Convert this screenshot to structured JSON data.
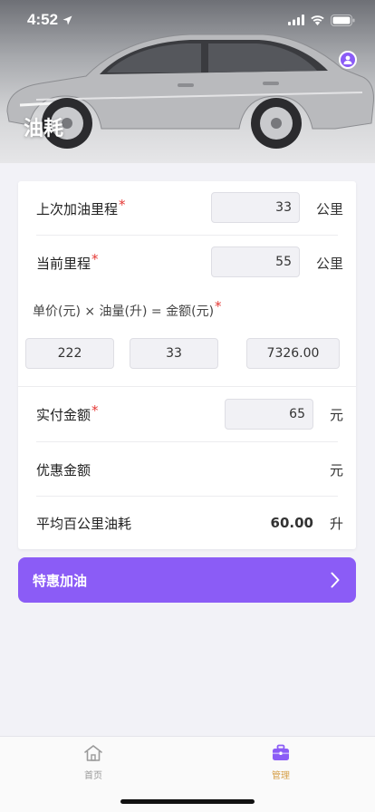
{
  "status": {
    "time": "4:52"
  },
  "header": {
    "title": "油耗"
  },
  "form": {
    "last_mileage": {
      "label": "上次加油里程",
      "value": "33",
      "unit": "公里",
      "required": "*"
    },
    "current_mileage": {
      "label": "当前里程",
      "value": "55",
      "unit": "公里",
      "required": "*"
    },
    "price_formula": {
      "label": "单价(元) × 油量(升) = 金额(元)",
      "required": "*",
      "unit_price": "222",
      "volume": "33",
      "amount": "7326.00"
    },
    "paid_amount": {
      "label": "实付金额",
      "value": "65",
      "unit": "元",
      "required": "*"
    },
    "discount_amount": {
      "label": "优惠金额",
      "unit": "元"
    },
    "avg_consumption": {
      "label": "平均百公里油耗",
      "value": "60.00",
      "unit": "升"
    }
  },
  "promo": {
    "label": "特惠加油"
  },
  "tabbar": {
    "tabs": [
      {
        "label": "首页",
        "icon": "home-icon",
        "active": false
      },
      {
        "label": "管理",
        "icon": "briefcase-icon",
        "active": true
      }
    ],
    "active_color": "#d6a04a",
    "inactive_color": "#999999"
  },
  "colors": {
    "accent": "#8b5cf6",
    "required": "#e53935"
  }
}
